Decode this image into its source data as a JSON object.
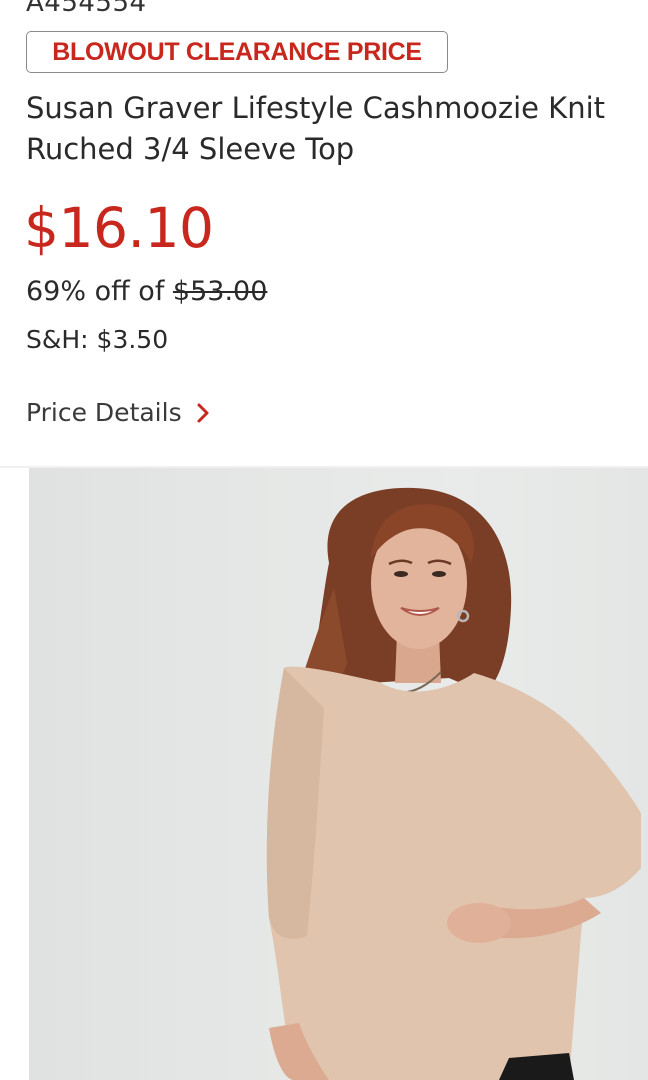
{
  "product": {
    "item_number": "A454554",
    "badge": "BLOWOUT CLEARANCE PRICE",
    "title": "Susan Graver Lifestyle Cashmoozie Knit Ruched 3/4 Sleeve Top",
    "price": "$16.10",
    "discount_text": "69% off of",
    "original_price": "$53.00",
    "shipping": "S&H: $3.50",
    "price_details_label": "Price Details"
  },
  "colors": {
    "accent_red": "#c8271d",
    "text": "#2a2a2a",
    "badge_border": "#8a8a8a"
  },
  "icons": {
    "price_details": "chevron-right-icon"
  },
  "image": {
    "subject": "model-wearing-beige-top"
  }
}
